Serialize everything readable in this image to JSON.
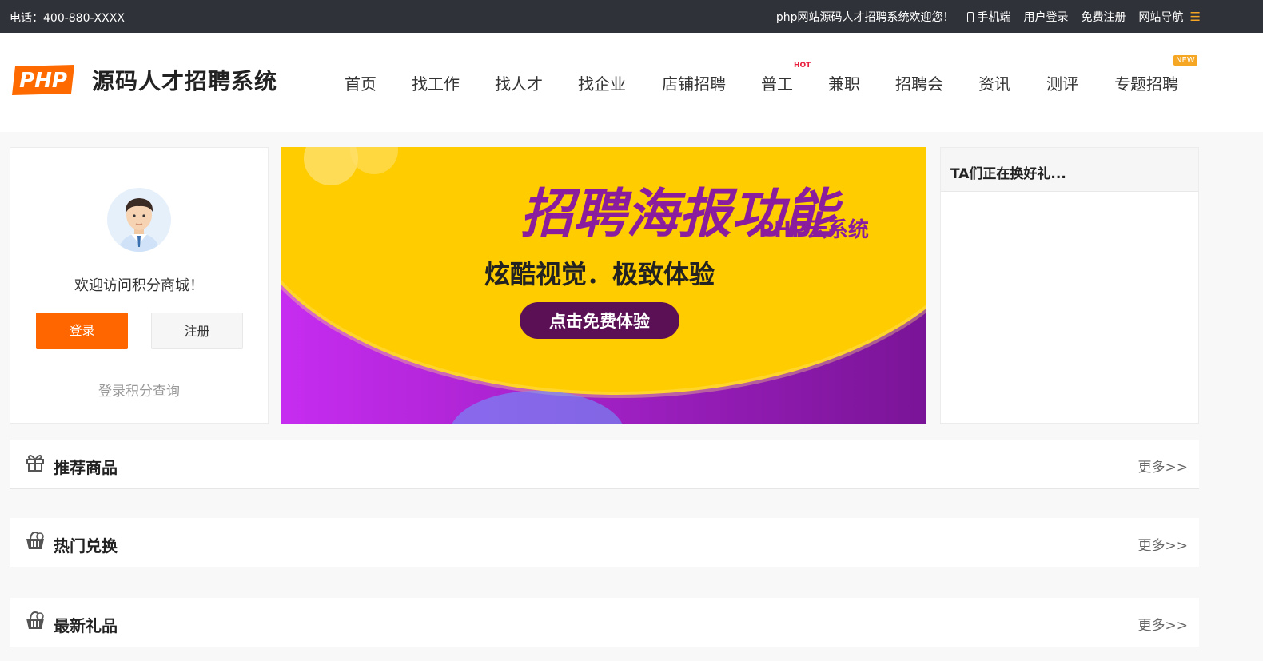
{
  "topbar": {
    "phone": "电话：400-880-XXXX",
    "welcome": "php网站源码人才招聘系统欢迎您！",
    "mobile": "手机端",
    "login": "用户登录",
    "register": "免费注册",
    "site_nav": "网站导航",
    "menu_icon": "☰"
  },
  "header": {
    "logo_text": "PHP",
    "brand": "源码人才招聘系统",
    "nav": [
      {
        "label": "首页"
      },
      {
        "label": "找工作"
      },
      {
        "label": "找人才"
      },
      {
        "label": "找企业"
      },
      {
        "label": "店铺招聘"
      },
      {
        "label": "普工",
        "badge": "HOT"
      },
      {
        "label": "兼职"
      },
      {
        "label": "招聘会"
      },
      {
        "label": "资讯"
      },
      {
        "label": "测评"
      },
      {
        "label": "专题招聘",
        "badge": "NEW"
      }
    ]
  },
  "user_card": {
    "welcome": "欢迎访问积分商城！",
    "login_button": "登录",
    "register_button": "注册",
    "points_link": "登录积分查询"
  },
  "banner": {
    "title": "招聘海报功能",
    "brand": "PHP云系统",
    "subtitle": "炫酷视觉．极致体验",
    "cta": "点击免费体验"
  },
  "right_panel": {
    "title": "TA们正在换好礼..."
  },
  "sections": [
    {
      "title": "推荐商品",
      "more": "更多>>",
      "icon": "gift-icon"
    },
    {
      "title": "热门兑换",
      "more": "更多>>",
      "icon": "basket-icon"
    },
    {
      "title": "最新礼品",
      "more": "更多>>",
      "icon": "basket-icon"
    }
  ],
  "colors": {
    "topbar": "#2f3238",
    "accent": "#ff6600",
    "banner_yellow": "#ffcc00",
    "banner_purple": "#8a1fb0",
    "banner_text": "#8a1c9e"
  }
}
